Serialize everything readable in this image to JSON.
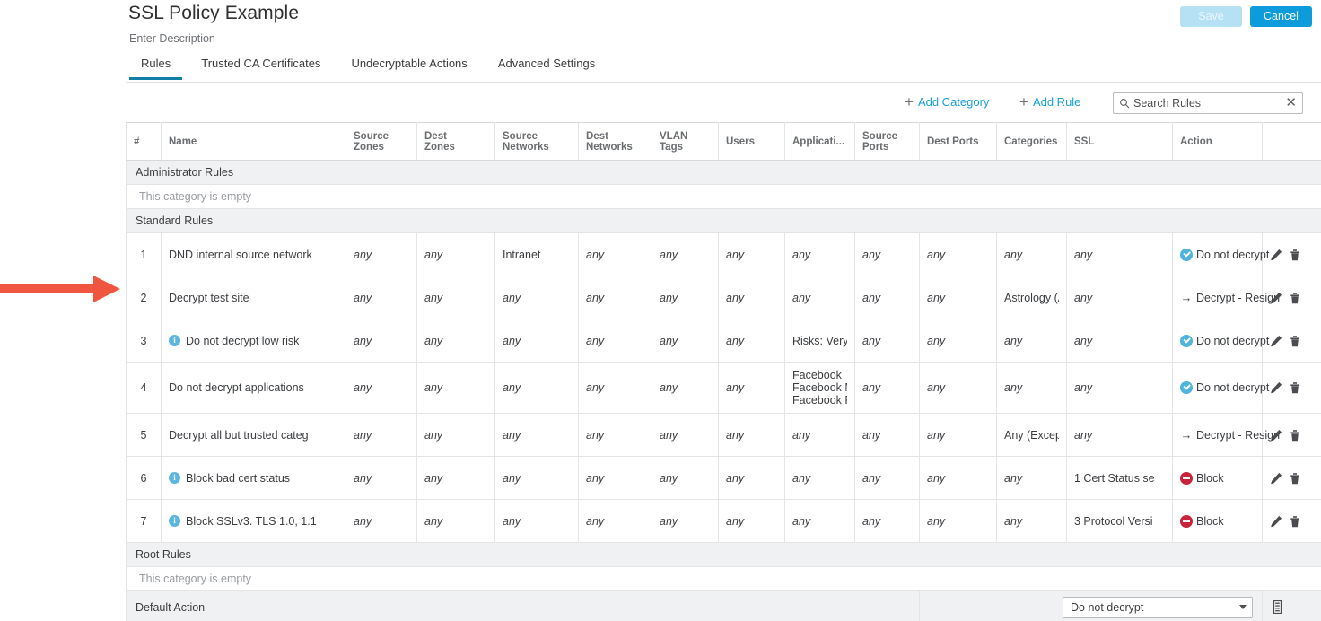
{
  "header": {
    "title": "SSL Policy Example",
    "description": "Enter Description",
    "save_label": "Save",
    "cancel_label": "Cancel"
  },
  "tabs": [
    {
      "label": "Rules",
      "active": true
    },
    {
      "label": "Trusted CA Certificates",
      "active": false
    },
    {
      "label": "Undecryptable Actions",
      "active": false
    },
    {
      "label": "Advanced Settings",
      "active": false
    }
  ],
  "toolbar": {
    "add_category_label": "Add Category",
    "add_rule_label": "Add Rule",
    "plus_glyph": "+",
    "search_placeholder": "Search Rules",
    "search_value": "",
    "clear_glyph": "✕"
  },
  "table": {
    "columns": [
      "#",
      "Name",
      "Source\nZones",
      "Dest\nZones",
      "Source\nNetworks",
      "Dest\nNetworks",
      "VLAN\nTags",
      "Users",
      "Applicati...",
      "Source\nPorts",
      "Dest Ports",
      "Categories",
      "SSL",
      "Action",
      ""
    ],
    "column_headers": {
      "num": "#",
      "name": "Name",
      "source_zones": "Source Zones",
      "dest_zones": "Dest Zones",
      "source_networks": "Source Networks",
      "dest_networks": "Dest Networks",
      "vlan_tags": "VLAN Tags",
      "users": "Users",
      "applications": "Applicati...",
      "source_ports": "Source Ports",
      "dest_ports": "Dest Ports",
      "categories": "Categories",
      "ssl": "SSL",
      "action": "Action"
    },
    "empty_category_text": "This category is empty",
    "categories": [
      {
        "name": "Administrator Rules",
        "empty": true
      },
      {
        "name": "Standard Rules",
        "empty": false
      },
      {
        "name": "Root Rules",
        "empty": true
      }
    ],
    "rules": [
      {
        "num": "1",
        "name": "DND internal source network",
        "info": false,
        "source_zones": "any",
        "dest_zones": "any",
        "source_networks": "Intranet",
        "dest_networks": "any",
        "vlan_tags": "any",
        "users": "any",
        "applications": "any",
        "source_ports": "any",
        "dest_ports": "any",
        "categories": "any",
        "ssl": "any",
        "action": "Do not decrypt",
        "action_icon": "check-circle-icon"
      },
      {
        "num": "2",
        "name": "Decrypt test site",
        "info": false,
        "source_zones": "any",
        "dest_zones": "any",
        "source_networks": "any",
        "dest_networks": "any",
        "vlan_tags": "any",
        "users": "any",
        "applications": "any",
        "source_ports": "any",
        "dest_ports": "any",
        "categories": "Astrology (Any",
        "ssl": "any",
        "action": "Decrypt - Resign",
        "action_icon": "arrow-right-icon"
      },
      {
        "num": "3",
        "name": "Do not decrypt low risk",
        "info": true,
        "source_zones": "any",
        "dest_zones": "any",
        "source_networks": "any",
        "dest_networks": "any",
        "vlan_tags": "any",
        "users": "any",
        "applications": "Risks: Very Lov",
        "source_ports": "any",
        "dest_ports": "any",
        "categories": "any",
        "ssl": "any",
        "action": "Do not decrypt",
        "action_icon": "check-circle-icon"
      },
      {
        "num": "4",
        "name": "Do not decrypt applications",
        "info": false,
        "source_zones": "any",
        "dest_zones": "any",
        "source_networks": "any",
        "dest_networks": "any",
        "vlan_tags": "any",
        "users": "any",
        "applications": "Facebook\nFacebook Mes\nFacebook Phot",
        "source_ports": "any",
        "dest_ports": "any",
        "categories": "any",
        "ssl": "any",
        "action": "Do not decrypt",
        "action_icon": "check-circle-icon"
      },
      {
        "num": "5",
        "name": "Decrypt all but trusted categ",
        "info": false,
        "source_zones": "any",
        "dest_zones": "any",
        "source_networks": "any",
        "dest_networks": "any",
        "vlan_tags": "any",
        "users": "any",
        "applications": "any",
        "source_ports": "any",
        "dest_ports": "any",
        "categories": "Any (Except Ur",
        "ssl": "any",
        "action": "Decrypt - Resign",
        "action_icon": "arrow-right-icon"
      },
      {
        "num": "6",
        "name": "Block bad cert status",
        "info": true,
        "source_zones": "any",
        "dest_zones": "any",
        "source_networks": "any",
        "dest_networks": "any",
        "vlan_tags": "any",
        "users": "any",
        "applications": "any",
        "source_ports": "any",
        "dest_ports": "any",
        "categories": "any",
        "ssl": "1 Cert Status se",
        "action": "Block",
        "action_icon": "block-circle-icon"
      },
      {
        "num": "7",
        "name": "Block SSLv3. TLS 1.0, 1.1",
        "info": true,
        "source_zones": "any",
        "dest_zones": "any",
        "source_networks": "any",
        "dest_networks": "any",
        "vlan_tags": "any",
        "users": "any",
        "applications": "any",
        "source_ports": "any",
        "dest_ports": "any",
        "categories": "any",
        "ssl": "3 Protocol Versi",
        "action": "Block",
        "action_icon": "block-circle-icon"
      }
    ],
    "default_action": {
      "label": "Default Action",
      "selected": "Do not decrypt"
    }
  },
  "colors": {
    "accent": "#0d9cdb",
    "tab_underline": "#0f7fa3",
    "ok": "#4eb3dd",
    "block": "#c9233a",
    "arrow_annotation": "#f05540"
  }
}
